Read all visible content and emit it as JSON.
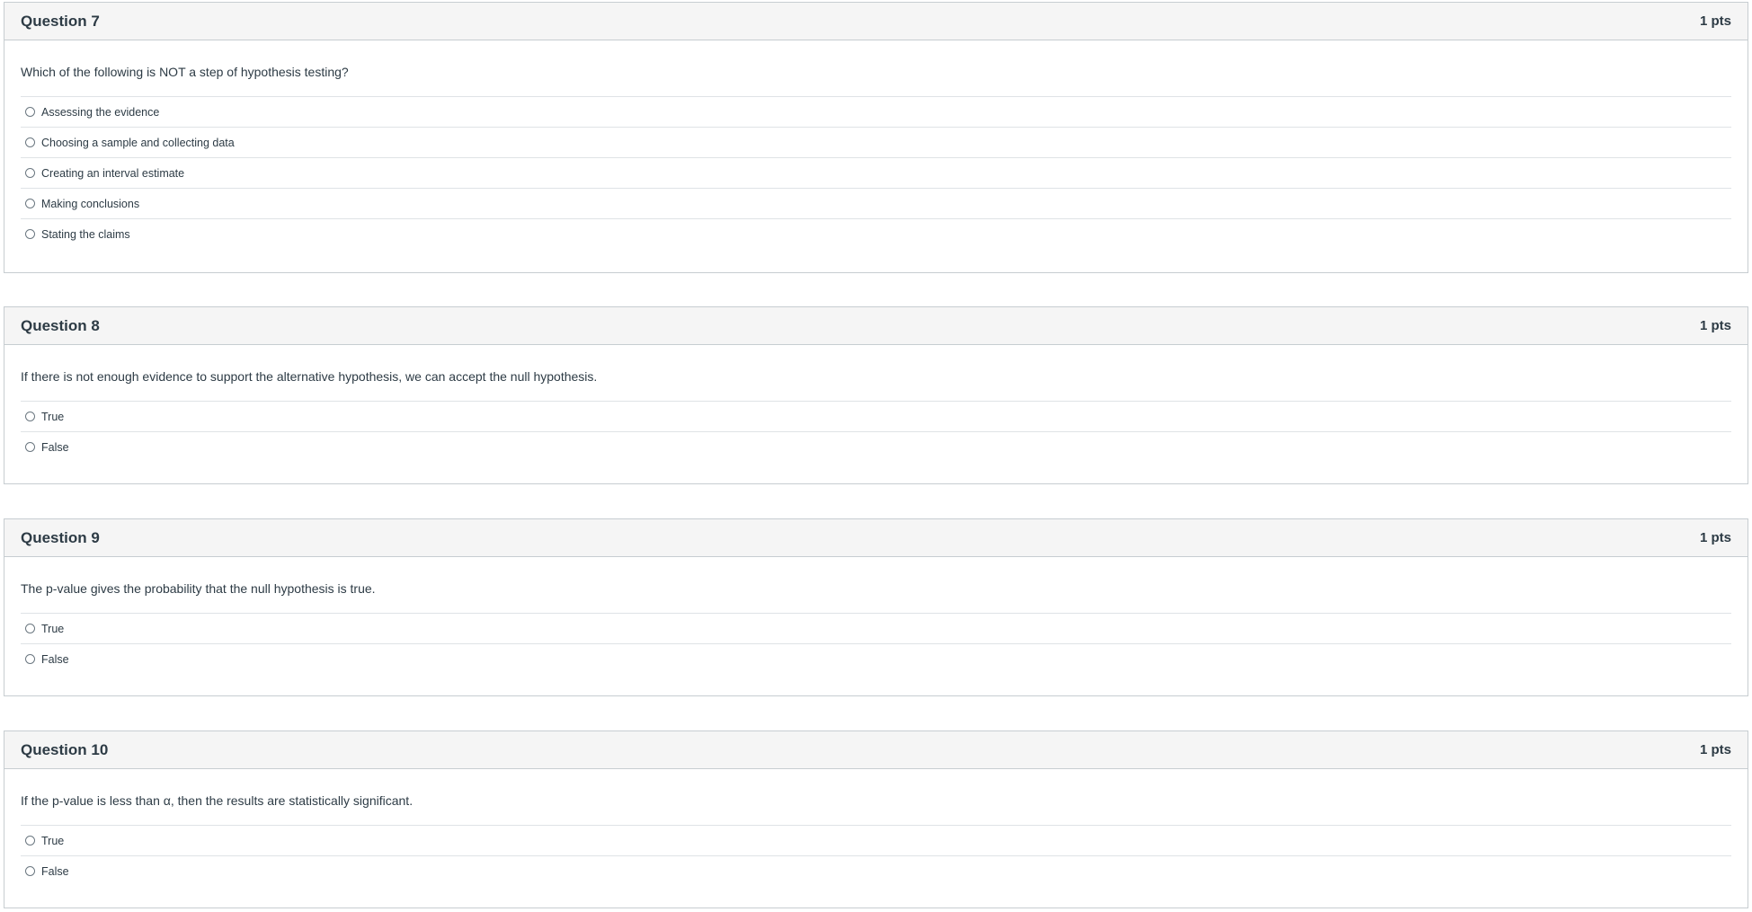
{
  "questions": [
    {
      "title": "Question 7",
      "points": "1 pts",
      "text": "Which of the following is NOT a step of hypothesis testing?",
      "answers": [
        "Assessing the evidence",
        "Choosing a sample and collecting data",
        "Creating an interval estimate",
        "Making conclusions",
        "Stating the claims"
      ]
    },
    {
      "title": "Question 8",
      "points": "1 pts",
      "text": "If there is not enough evidence to support the alternative hypothesis, we can accept the null hypothesis.",
      "answers": [
        "True",
        "False"
      ]
    },
    {
      "title": "Question 9",
      "points": "1 pts",
      "text": "The p-value gives the probability that the null hypothesis is true.",
      "answers": [
        "True",
        "False"
      ]
    },
    {
      "title": "Question 10",
      "points": "1 pts",
      "text": "If the p-value is less than α, then the results are statistically significant.",
      "answers": [
        "True",
        "False"
      ]
    }
  ]
}
